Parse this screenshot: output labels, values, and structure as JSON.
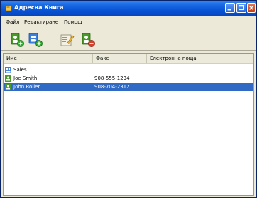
{
  "window": {
    "title": "Адресна Книга"
  },
  "menu": {
    "items": [
      {
        "label": "Файл"
      },
      {
        "label": "Редактиране"
      },
      {
        "label": "Помощ"
      }
    ]
  },
  "toolbar": {
    "buttons": [
      {
        "icon": "add-contact-icon"
      },
      {
        "icon": "add-group-icon"
      },
      {
        "icon": "edit-icon"
      },
      {
        "icon": "delete-icon"
      }
    ]
  },
  "list": {
    "columns": [
      "Име",
      "Факс",
      "Електронна поща"
    ],
    "rows": [
      {
        "type": "group",
        "name": "Sales",
        "fax": "",
        "email": ""
      },
      {
        "type": "contact",
        "name": "Joe Smith",
        "fax": "908-555-1234",
        "email": ""
      },
      {
        "type": "contact",
        "name": "John Roller",
        "fax": "908-704-2312",
        "email": "",
        "selected": true
      }
    ]
  },
  "colors": {
    "titlebar": "#0a56d6",
    "selection": "#316ac5",
    "window_bg": "#ece9d8"
  }
}
